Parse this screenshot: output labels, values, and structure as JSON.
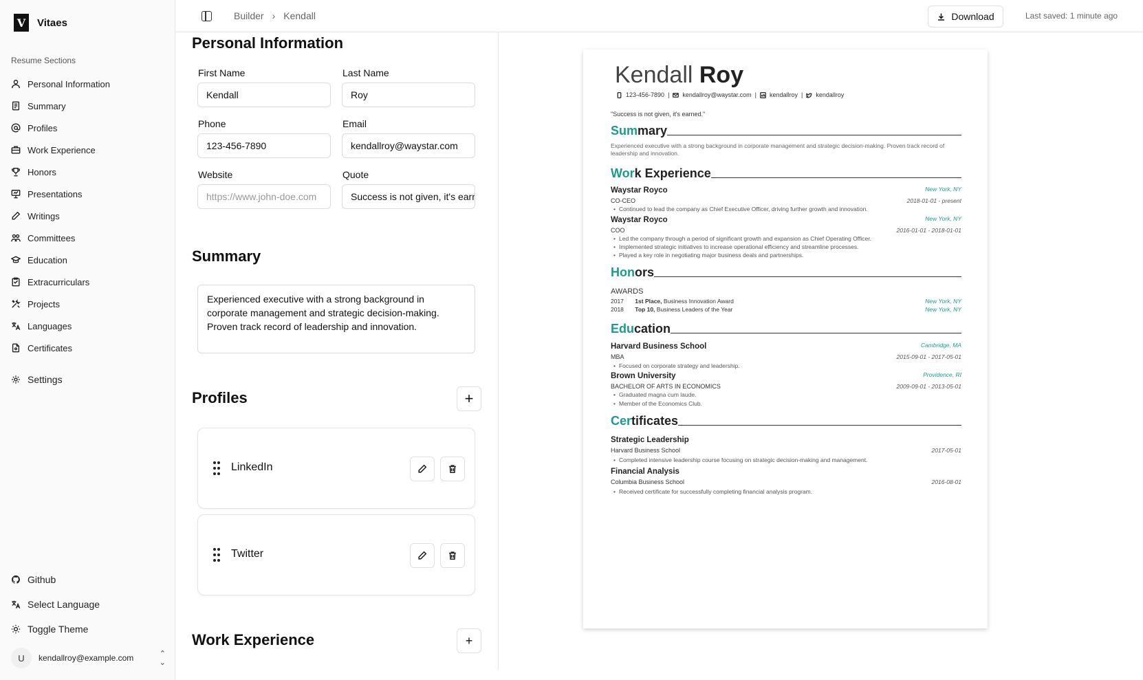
{
  "brand": {
    "name": "Vitaes",
    "logo": "V"
  },
  "sidebar": {
    "section_title": "Resume Sections",
    "items": [
      {
        "label": "Personal Information",
        "icon": "user-icon"
      },
      {
        "label": "Summary",
        "icon": "document-icon"
      },
      {
        "label": "Profiles",
        "icon": "at-icon"
      },
      {
        "label": "Work Experience",
        "icon": "briefcase-icon"
      },
      {
        "label": "Honors",
        "icon": "trophy-icon"
      },
      {
        "label": "Presentations",
        "icon": "presentation-icon"
      },
      {
        "label": "Writings",
        "icon": "pen-icon"
      },
      {
        "label": "Committees",
        "icon": "people-icon"
      },
      {
        "label": "Education",
        "icon": "graduation-icon"
      },
      {
        "label": "Extracurriculars",
        "icon": "clipboard-icon"
      },
      {
        "label": "Projects",
        "icon": "tools-icon"
      },
      {
        "label": "Languages",
        "icon": "language-icon"
      },
      {
        "label": "Certificates",
        "icon": "certificate-icon"
      }
    ],
    "settings": "Settings",
    "footer": {
      "github": "Github",
      "language": "Select Language",
      "theme": "Toggle Theme"
    },
    "user": {
      "initial": "U",
      "email": "kendallroy@example.com"
    }
  },
  "header": {
    "breadcrumb": [
      "Builder",
      "Kendall"
    ],
    "separator": "›",
    "download": "Download",
    "last_saved": "Last saved: 1 minute ago"
  },
  "editor": {
    "personal": {
      "title": "Personal Information",
      "first_name_label": "First Name",
      "first_name": "Kendall",
      "last_name_label": "Last Name",
      "last_name": "Roy",
      "phone_label": "Phone",
      "phone": "123-456-7890",
      "email_label": "Email",
      "email": "kendallroy@waystar.com",
      "website_label": "Website",
      "website_placeholder": "https://www.john-doe.com",
      "quote_label": "Quote",
      "quote": "Success is not given, it's earned."
    },
    "summary": {
      "title": "Summary",
      "text": "Experienced executive with a strong background in corporate management and strategic decision-making. Proven track record of leadership and innovation."
    },
    "profiles": {
      "title": "Profiles",
      "add": "+",
      "items": [
        "LinkedIn",
        "Twitter"
      ]
    },
    "work": {
      "title": "Work Experience",
      "add": "+"
    }
  },
  "resume": {
    "first": "Kendall",
    "last": "Roy",
    "phone": "123-456-7890",
    "email": "kendallroy@waystar.com",
    "linkedin": "kendallroy",
    "twitter": "kendallroy",
    "divider": "|",
    "quote": "\"Success is not given, it's earned.\"",
    "summary": {
      "title_acc": "Sum",
      "title_rest": "mary",
      "text": "Experienced executive with a strong background in corporate management and strategic decision-making. Proven track record of leadership and innovation."
    },
    "work": {
      "title_acc": "Wor",
      "title_rest": "k Experience",
      "entries": [
        {
          "company": "Waystar Royco",
          "location": "New York, NY",
          "role": "CO-CEO",
          "dates": "2018-01-01 - present",
          "bullets": [
            "Continued to lead the company as Chief Executive Officer, driving further growth and innovation."
          ]
        },
        {
          "company": "Waystar Royco",
          "location": "New York, NY",
          "role": "COO",
          "dates": "2016-01-01 - 2018-01-01",
          "bullets": [
            "Led the company through a period of significant growth and expansion as Chief Operating Officer.",
            "Implemented strategic initiatives to increase operational efficiency and streamline processes.",
            "Played a key role in negotiating major business deals and partnerships."
          ]
        }
      ]
    },
    "honors": {
      "title_acc": "Hon",
      "title_rest": "ors",
      "category": "AWARDS",
      "rows": [
        {
          "year": "2017",
          "place": "1st Place,",
          "award": "Business Innovation Award",
          "location": "New York, NY"
        },
        {
          "year": "2018",
          "place": "Top 10,",
          "award": "Business Leaders of the Year",
          "location": "New York, NY"
        }
      ]
    },
    "education": {
      "title_acc": "Edu",
      "title_rest": "cation",
      "entries": [
        {
          "school": "Harvard Business School",
          "location": "Cambridge, MA",
          "degree": "MBA",
          "dates": "2015-09-01 - 2017-05-01",
          "bullets": [
            "Focused on corporate strategy and leadership."
          ]
        },
        {
          "school": "Brown University",
          "location": "Providence, RI",
          "degree": "BACHELOR OF ARTS IN ECONOMICS",
          "dates": "2009-09-01 - 2013-05-01",
          "bullets": [
            "Graduated magna cum laude.",
            "Member of the Economics Club."
          ]
        }
      ]
    },
    "certificates": {
      "title_acc": "Cer",
      "title_rest": "tificates",
      "entries": [
        {
          "name": "Strategic Leadership",
          "issuer": "Harvard Business School",
          "date": "2017-05-01",
          "bullets": [
            "Completed intensive leadership course focusing on strategic decision-making and management."
          ]
        },
        {
          "name": "Financial Analysis",
          "issuer": "Columbia Business School",
          "date": "2016-08-01",
          "bullets": [
            "Received certificate for successfully completing financial analysis program."
          ]
        }
      ]
    }
  },
  "colors": {
    "accent": "#1a9b8e",
    "sidebar_bg": "#fafafa",
    "border": "#e5e5e5"
  }
}
